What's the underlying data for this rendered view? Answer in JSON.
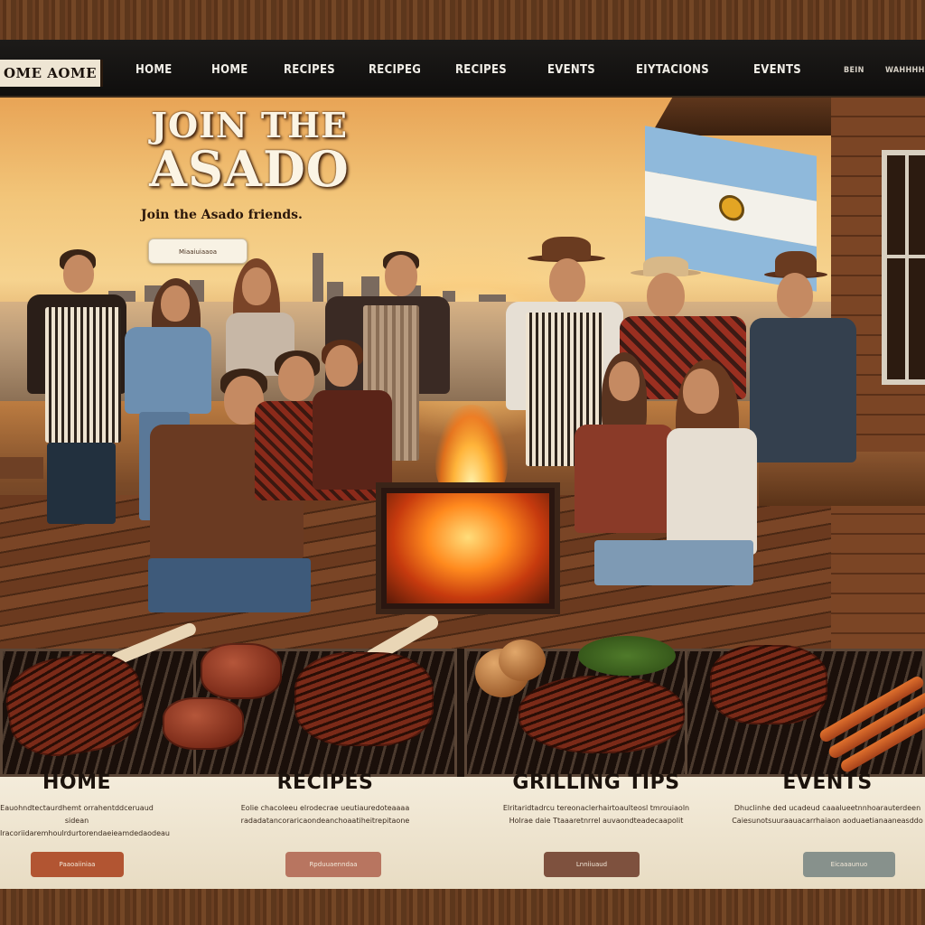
{
  "nav": {
    "brand": "OME AOME",
    "items": [
      "HOME",
      "HOME",
      "RECIPES",
      "RECIPEG",
      "RECIPES",
      "EVENTS",
      "EIYTACIONS",
      "EVENTS",
      "BEIN",
      "WAHHHHAIS"
    ]
  },
  "hero": {
    "title_line1": "JOIN THE",
    "title_line2": "ASADO",
    "subtitle": "Join the Asado friends.",
    "button_label": "Miaaiuiaaoa"
  },
  "cards": [
    {
      "title": "HOME",
      "text": "Eauohndtectaurdhemt orrahentddceruaud sidean\nIracoriidaremhoulrdurtorendaeieamdedaodeau",
      "button_label": "Paaoaiiniaa",
      "button_color": "#b25532"
    },
    {
      "title": "RECIPES",
      "text": "Eolie chacoleeu elrodecrae ueutiauredoteaaaa\nradadatancoraricaondeanchoaatiheitrepitaone",
      "button_label": "Rpduuaenndaa",
      "button_color": "#b87560"
    },
    {
      "title": "GRILLING TIPS",
      "text": "Elritaridtadrcu tereonaclerhairtoaulteosl tmrouiaoln\nHolrae daie Ttaaaretnrrel auvaondteadecaapolit",
      "button_label": "Lnniiuaud",
      "button_color": "#7e513e"
    },
    {
      "title": "EVENTS",
      "text": "Dhuclinhe ded ucadeud caaalueetnnhoarauterdeen\nCaiesunotsuuraauacarrhaiaon aoduaetianaaneasddo",
      "button_label": "Eicaaaunuo",
      "button_color": "#87918c"
    }
  ]
}
